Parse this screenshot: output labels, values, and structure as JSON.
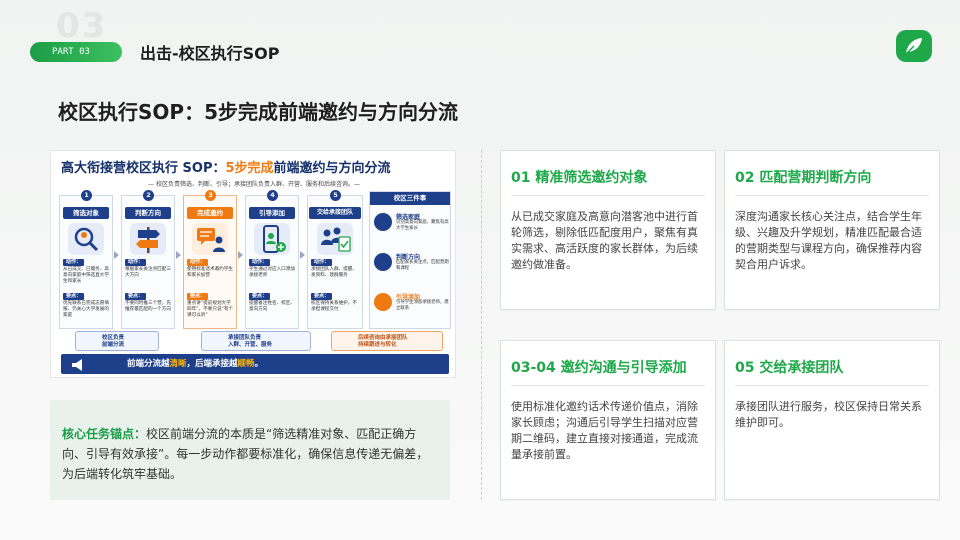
{
  "header": {
    "watermark": "03",
    "part": "PART 03",
    "title": "出击-校区执行SOP"
  },
  "main_title": "校区执行SOP：5步完成前端邀约与方向分流",
  "infographic": {
    "title_pre": "高大衔接营校区执行 SOP：",
    "title_hl": "5步完成",
    "title_post": "前端邀约与方向分流",
    "subtitle": "— 校区负责筛选、判断、引导；承接团队负责入群、开营、服务和后续咨询。—",
    "steps": [
      {
        "num": "1",
        "label": "筛选对象",
        "action": "从已成交、已服务、高意向家庭中筛选直大学生和家长",
        "point": "优先联系已完成志愿填报、仍关心大学发展的家庭"
      },
      {
        "num": "2",
        "label": "判断方向",
        "action": "根据家长关注点匹配三大方向",
        "point": "不要同时推三个营，先推荐最匹配的一个方向"
      },
      {
        "num": "3",
        "label": "完成邀约",
        "action": "使用标准话术邀约学生和家长加营",
        "point": "重点讲“提前规划大学四年”，不要只说“有个课可以听”"
      },
      {
        "num": "4",
        "label": "引导添加",
        "action": "学生通过对应入口添加承接老师",
        "point": "提醒备注姓名、校区、意向方向"
      },
      {
        "num": "5",
        "label": "交给承接团队",
        "action": "承接团队入群、提醒、发资料、建群服务",
        "point": "校区保持关系维护，不承担课程交付"
      }
    ],
    "tag_action": "动作：",
    "tag_point": "要点：",
    "side": {
      "header": "校区三件事",
      "items": [
        {
          "title": "筛选家庭",
          "desc": "识别高意向家庭，聚焦有高大学生家长"
        },
        {
          "title": "判断方向",
          "desc": "匹配家长关注点，匹配营期和课程"
        },
        {
          "title": "引导添加",
          "desc": "引导学生添加承接老师，建立联系"
        }
      ]
    },
    "bottom": [
      {
        "text": "校区负责\n前端分流"
      },
      {
        "text": "承接团队负责\n入群、开营、服务"
      },
      {
        "text": "后续咨询由承接团队\n持续跟进与转化"
      }
    ],
    "banner_pre": "前端分流越",
    "banner_hl1": "清晰",
    "banner_mid": "，后端承接越",
    "banner_hl2": "顺畅",
    "banner_end": "。"
  },
  "core": {
    "label": "核心任务锚点：",
    "text": "校区前端分流的本质是“筛选精准对象、匹配正确方向、引导有效承接”。每一步动作都要标准化，确保信息传递无偏差，为后端转化筑牢基础。"
  },
  "cards": [
    {
      "title": "01 精准筛选邀约对象",
      "body": "从已成交家庭及高意向潜客池中进行首轮筛选，剔除低匹配度用户，聚焦有真实需求、高活跃度的家长群体，为后续邀约做准备。"
    },
    {
      "title": "02 匹配营期判断方向",
      "body": "深度沟通家长核心关注点，结合学生年级、兴趣及升学规划，精准匹配最合适的营期类型与课程方向，确保推荐内容契合用户诉求。"
    },
    {
      "title": "03-04 邀约沟通与引导添加",
      "body": "使用标准化邀约话术传递价值点，消除家长顾虑；沟通后引导学生扫描对应营期二维码，建立直接对接通道，完成流量承接前置。"
    },
    {
      "title": "05 交给承接团队",
      "body": "承接团队进行服务，校区保持日常关系维护即可。"
    }
  ],
  "colors": {
    "accent": "#1ea84a",
    "navy": "#1e3f8a",
    "orange": "#f07a12"
  }
}
